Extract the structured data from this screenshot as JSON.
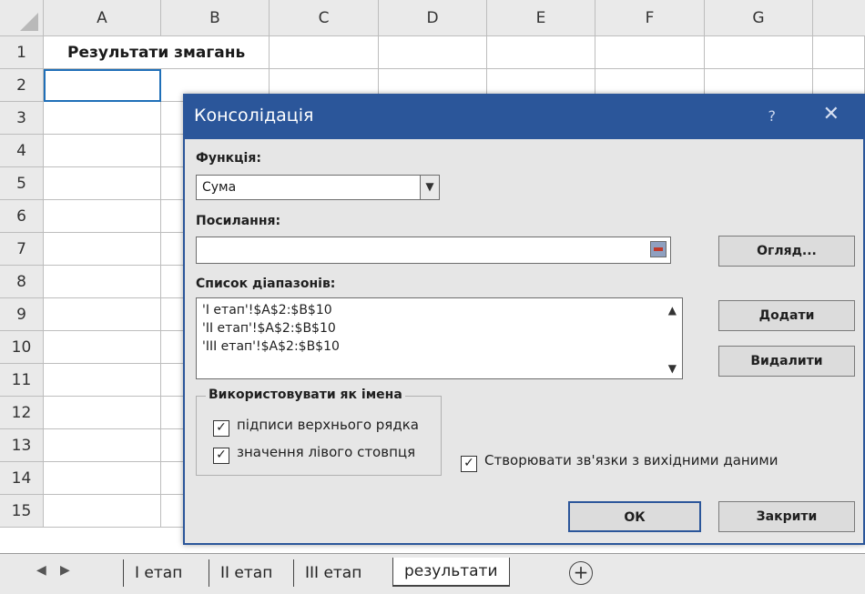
{
  "spreadsheet": {
    "columns": [
      "A",
      "B",
      "C",
      "D",
      "E",
      "F",
      "G"
    ],
    "rows": [
      "1",
      "2",
      "3",
      "4",
      "5",
      "6",
      "7",
      "8",
      "9",
      "10",
      "11",
      "12",
      "13",
      "14",
      "15"
    ],
    "cell_a1": "Результати змагань"
  },
  "dialog": {
    "title": "Консолідація",
    "help_icon": "?",
    "close_icon": "✕",
    "function_label": "Функція:",
    "function_value": "Сума",
    "reference_label": "Посилання:",
    "reference_value": "",
    "ranges_label": "Список діапазонів:",
    "ranges": [
      "'I етап'!$A$2:$B$10",
      "'II етап'!$A$2:$B$10",
      "'III етап'!$A$2:$B$10"
    ],
    "browse_button": "Огляд...",
    "add_button": "Додати",
    "delete_button": "Видалити",
    "use_labels_legend": "Використовувати як імена",
    "top_row_label": "підписи верхнього рядка",
    "top_row_checked": true,
    "left_column_label": "значення лівого стовпця",
    "left_column_checked": true,
    "create_links_label": "Створювати зв'язки з вихідними даними",
    "create_links_checked": true,
    "ok_button": "ОК",
    "close_button": "Закрити"
  },
  "sheet_tabs": {
    "nav_prev": "◀",
    "nav_next": "▶",
    "tabs": [
      "І етап",
      "ІІ етап",
      "ІІІ етап",
      "результати"
    ],
    "active_tab": "результати",
    "add_sheet": "+"
  },
  "colors": {
    "dialog_title_bar": "#2b569a",
    "dialog_background": "#e6e6e6",
    "header_background": "#eaeaea",
    "active_cell_border": "#1f6fb8"
  }
}
